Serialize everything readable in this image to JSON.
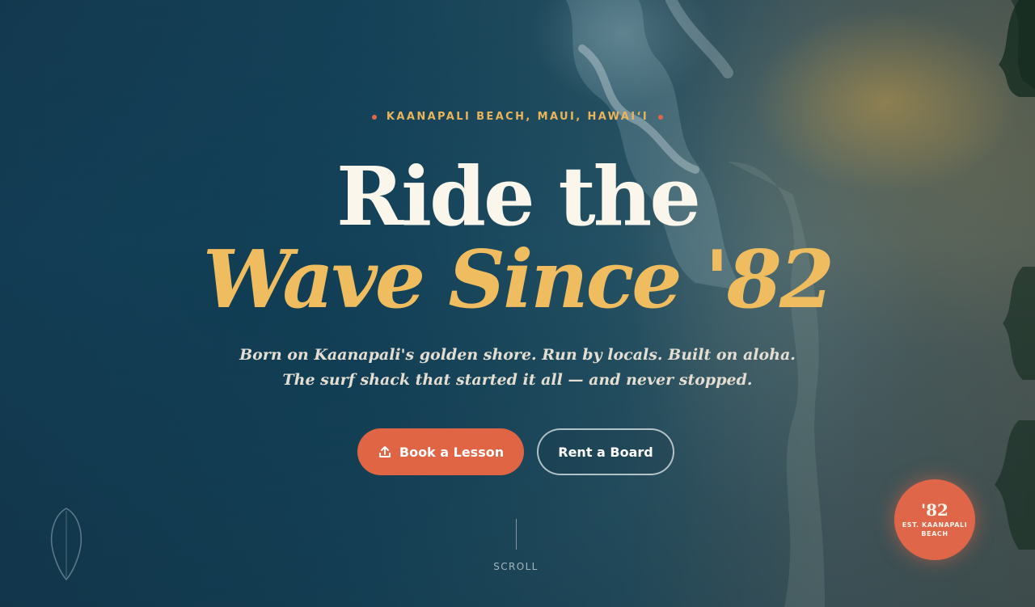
{
  "hero": {
    "location": "KAANAPALI BEACH, MAUI, HAWAI‘I",
    "headline_line1": "Ride the",
    "headline_line2": "Wave Since '82",
    "subtitle": "Born on Kaanapali's golden shore. Run by locals. Built on aloha. The surf shack that started it all — and never stopped."
  },
  "actions": {
    "primary_label": "Book a Lesson",
    "primary_icon": "upload-arrow-icon",
    "secondary_label": "Rent a Board"
  },
  "scroll": {
    "label": "SCROLL"
  },
  "badge": {
    "year": "'82",
    "caption": "EST. KAANAPALI BEACH"
  },
  "colors": {
    "accent_coral": "#df6545",
    "accent_gold": "#efbd5f",
    "headline_cream": "#fbf6ec",
    "ocean_dark": "#16384a"
  },
  "icons": {
    "surfboard": "surfboard-outline-icon",
    "location_dots": "dot-icon"
  }
}
